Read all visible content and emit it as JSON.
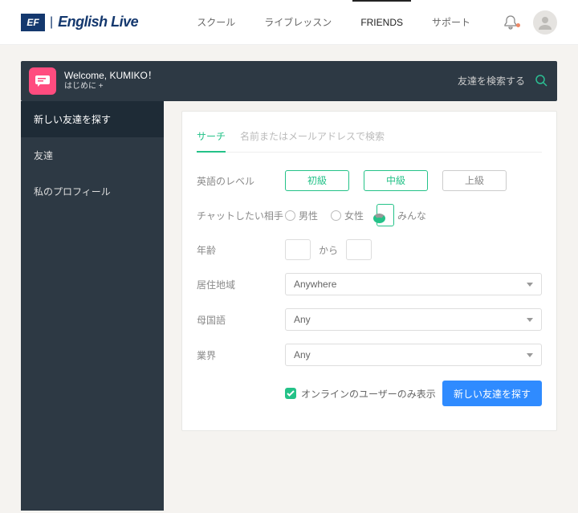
{
  "brand": {
    "mark": "EF",
    "name": "English Live"
  },
  "nav": {
    "items": [
      {
        "label": "スクール"
      },
      {
        "label": "ライブレッスン"
      },
      {
        "label": "FRIENDS"
      },
      {
        "label": "サポート"
      }
    ],
    "activeIndex": 2
  },
  "welcome": {
    "title": "Welcome, KUMIKO！",
    "subtitle": "はじめに  +",
    "searchPlaceholder": "友達を検索する"
  },
  "sidebar": {
    "items": [
      {
        "label": "新しい友達を探す"
      },
      {
        "label": "友達"
      },
      {
        "label": "私のプロフィール"
      }
    ],
    "activeIndex": 0
  },
  "tabs": {
    "items": [
      {
        "label": "サーチ"
      },
      {
        "label": "名前またはメールアドレスで検索"
      }
    ],
    "activeIndex": 0
  },
  "form": {
    "level": {
      "label": "英語のレベル",
      "options": [
        "初級",
        "中級",
        "上級"
      ],
      "selected": [
        0,
        1
      ]
    },
    "chatWith": {
      "label": "チャットしたい相手",
      "options": [
        "男性",
        "女性",
        "みんな"
      ],
      "selectedIndex": 2
    },
    "age": {
      "label": "年齢",
      "from": "",
      "to": "",
      "separator": "から"
    },
    "region": {
      "label": "居住地域",
      "value": "Anywhere"
    },
    "native": {
      "label": "母国語",
      "value": "Any"
    },
    "industry": {
      "label": "業界",
      "value": "Any"
    },
    "onlineOnly": {
      "checked": true,
      "label": "オンラインのユーザーのみ表示"
    },
    "submit": "新しい友達を探す"
  }
}
